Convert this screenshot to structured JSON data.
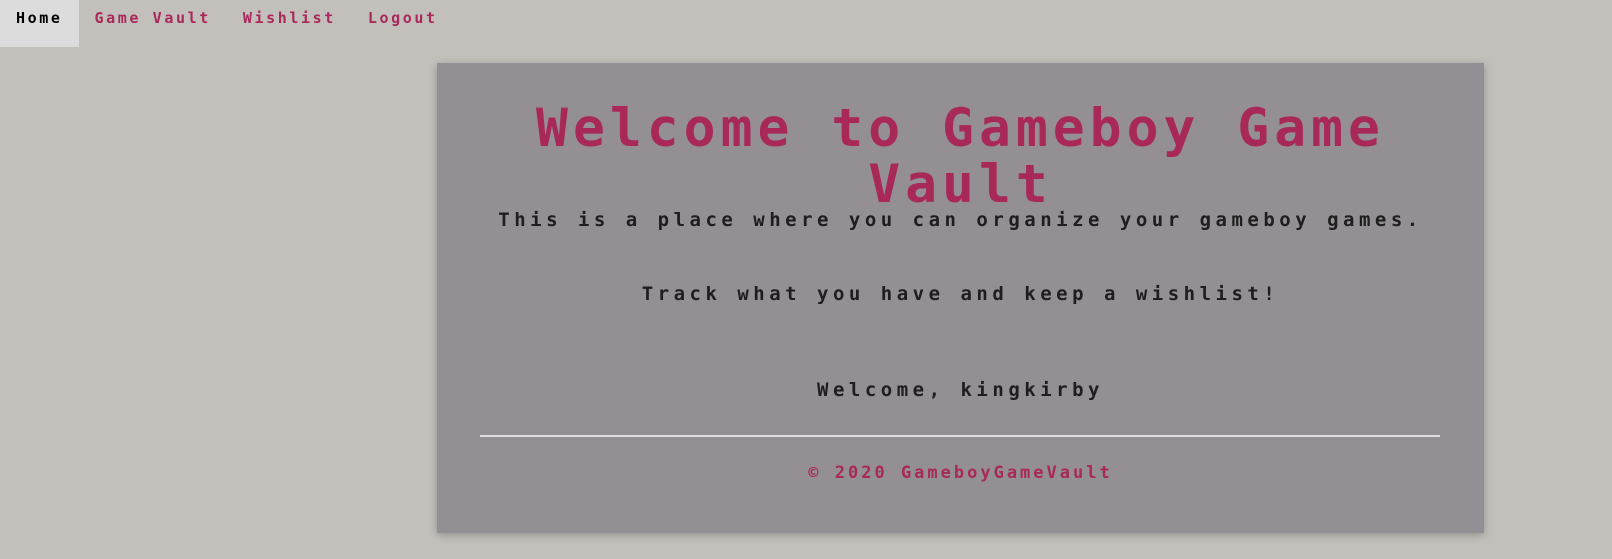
{
  "nav": {
    "items": [
      {
        "label": "Home",
        "active": true
      },
      {
        "label": "Game Vault"
      },
      {
        "label": "Wishlist"
      },
      {
        "label": "Logout"
      }
    ]
  },
  "main": {
    "title": "Welcome to Gameboy Game Vault",
    "intro": "This is a place where you can organize your gameboy games.",
    "tagline": "Track what you have and keep a wishlist!",
    "welcome": "Welcome, kingkirby",
    "footer": "© 2020 GameboyGameVault"
  },
  "colors": {
    "accent": "#a8285a",
    "background": "#c3c0bb",
    "card": "#948f94"
  }
}
